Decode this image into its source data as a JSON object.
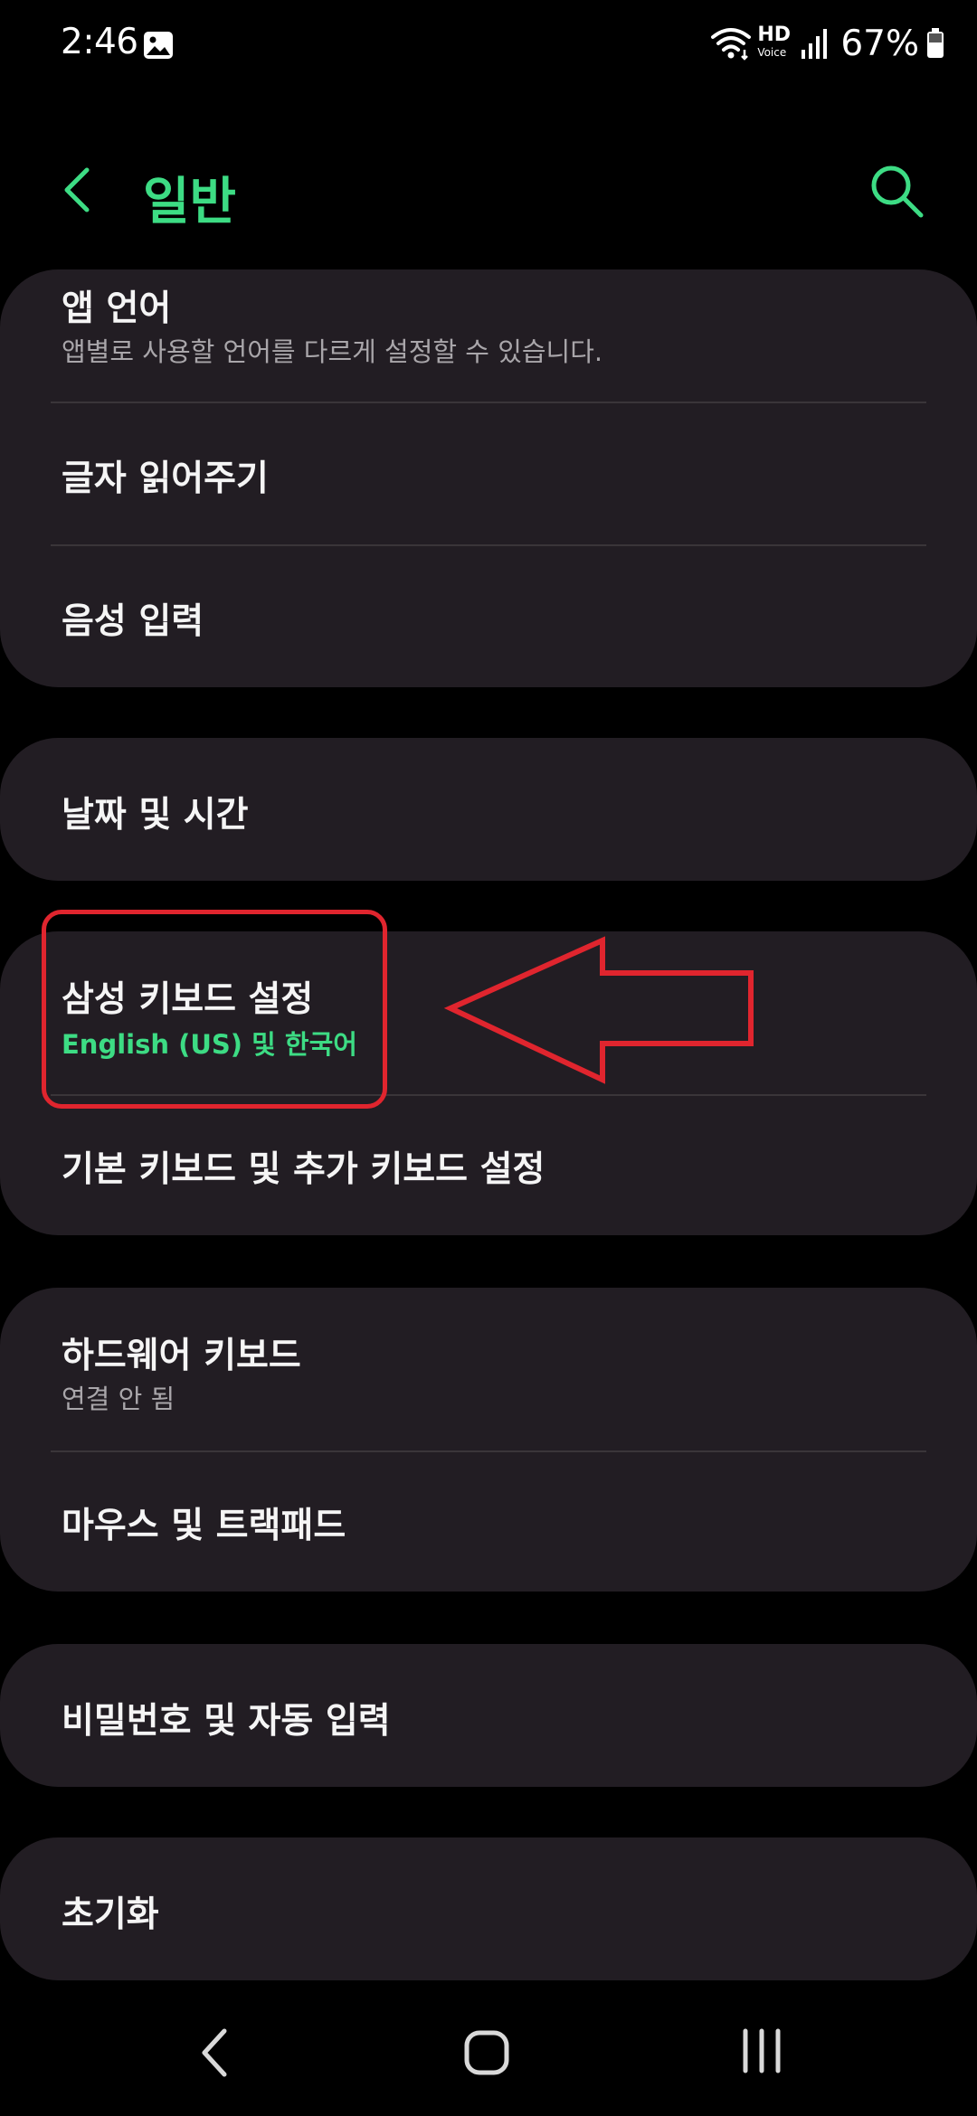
{
  "status_bar": {
    "time": "2:46",
    "hd_label": "HD",
    "voice_label": "Voice",
    "battery_percent": "67%",
    "icons": [
      "photo-icon",
      "wifi-icon",
      "hd-voice-icon",
      "signal-icon",
      "battery-icon"
    ]
  },
  "header": {
    "title": "일반",
    "icons": [
      "back-arrow-icon",
      "search-icon"
    ]
  },
  "groups": {
    "language": {
      "app_language_title": "앱 언어",
      "app_language_sub": "앱별로 사용할 언어를 다르게 설정할 수 있습니다.",
      "tts_title": "글자 읽어주기",
      "voice_input_title": "음성 입력"
    },
    "datetime": {
      "title": "날짜 및 시간"
    },
    "keyboard": {
      "samsung_keyboard_title": "삼성 키보드 설정",
      "samsung_keyboard_sub": "English (US) 및 한국어",
      "default_keyboard_title": "기본 키보드 및 추가 키보드 설정"
    },
    "hardware": {
      "hardware_keyboard_title": "하드웨어 키보드",
      "hardware_keyboard_sub": "연결 안 됨",
      "mouse_title": "마우스 및 트랙패드"
    },
    "password": {
      "title": "비밀번호 및 자동 입력"
    },
    "reset": {
      "title": "초기화"
    }
  },
  "annotation": {
    "color": "#e0252e",
    "shapes": [
      "highlight-box",
      "left-arrow"
    ]
  },
  "nav_bar": {
    "icons": [
      "back-icon",
      "home-icon",
      "recents-icon"
    ]
  },
  "colors": {
    "background": "#000000",
    "card": "#221d23",
    "accent": "#3ddc84",
    "text_primary": "#f5f5f5",
    "text_secondary": "#a9a6aa",
    "divider": "#3a3539"
  }
}
